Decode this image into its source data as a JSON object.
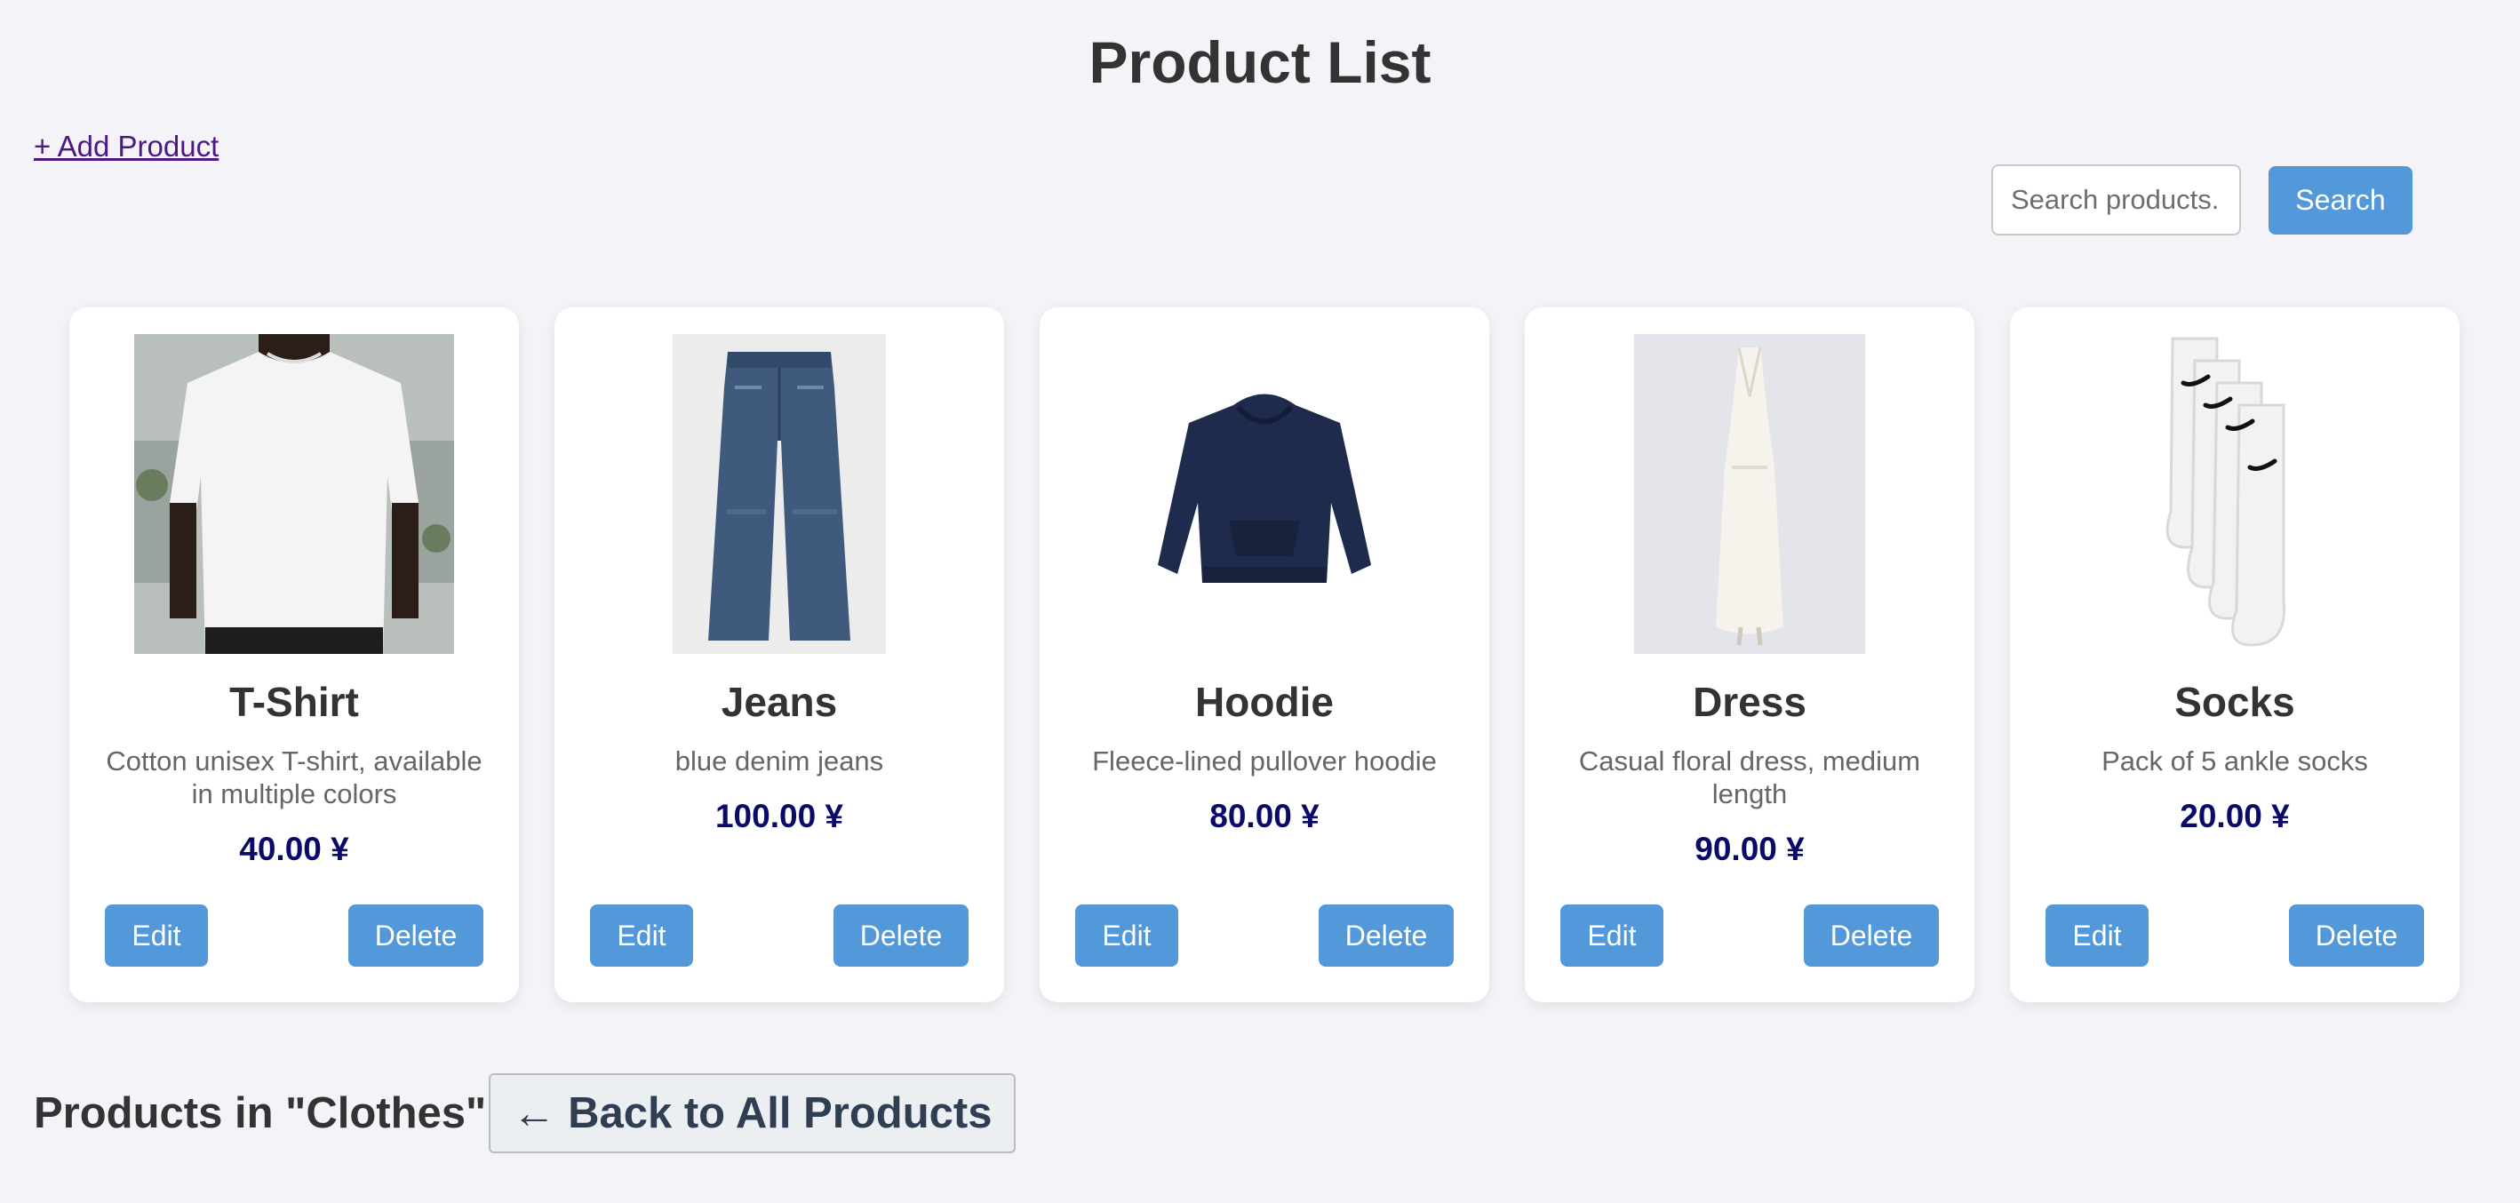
{
  "page": {
    "title": "Product List",
    "add_link": "+ Add Product"
  },
  "search": {
    "placeholder": "Search products...",
    "button_label": "Search"
  },
  "products": [
    {
      "name": "T-Shirt",
      "description": "Cotton unisex T-shirt, available in multiple colors",
      "price": "40.00 ¥",
      "edit_label": "Edit",
      "delete_label": "Delete"
    },
    {
      "name": "Jeans",
      "description": "blue denim jeans",
      "price": "100.00 ¥",
      "edit_label": "Edit",
      "delete_label": "Delete"
    },
    {
      "name": "Hoodie",
      "description": "Fleece-lined pullover hoodie",
      "price": "80.00 ¥",
      "edit_label": "Edit",
      "delete_label": "Delete"
    },
    {
      "name": "Dress",
      "description": "Casual floral dress, medium length",
      "price": "90.00 ¥",
      "edit_label": "Edit",
      "delete_label": "Delete"
    },
    {
      "name": "Socks",
      "description": "Pack of 5 ankle socks",
      "price": "20.00 ¥",
      "edit_label": "Edit",
      "delete_label": "Delete"
    }
  ],
  "category": {
    "heading": "Products in \"Clothes\"",
    "back_label": "← Back to All Products"
  },
  "colors": {
    "accent": "#5398d8",
    "price": "#0a0a6a",
    "link": "#4b1a86",
    "background": "#f3f3f8"
  }
}
